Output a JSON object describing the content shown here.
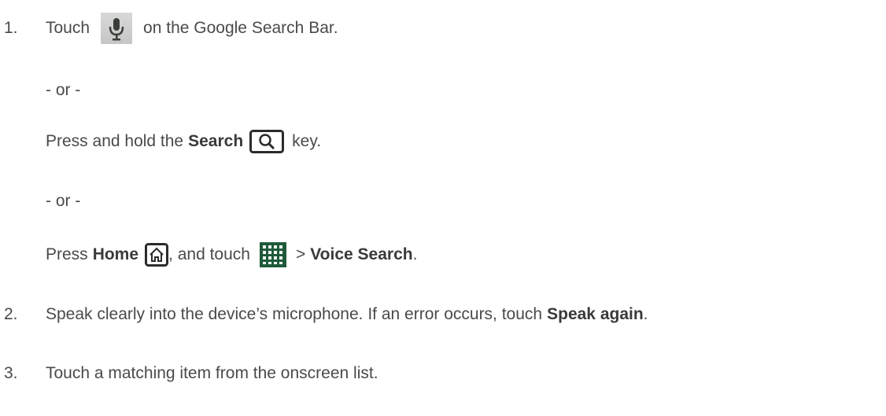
{
  "steps": [
    {
      "number": "1.",
      "lead": "Touch",
      "tail": "on the Google Search Bar."
    }
  ],
  "alt1": {
    "or": "- or -",
    "press": "Press and hold the",
    "key_name": "Search",
    "tail": "key."
  },
  "alt2": {
    "or": "- or -",
    "press": "Press",
    "key_name": "Home",
    "mid": ", and touch",
    "arrow": ">",
    "target": "Voice Search",
    "tail": "."
  },
  "step2": {
    "number": "2.",
    "text": "Speak clearly into the device’s microphone. If an error occurs, touch",
    "bold": "Speak again",
    "tail": "."
  },
  "step3": {
    "number": "3.",
    "text": "Touch a matching item from the onscreen list."
  },
  "icons": {
    "mic": "microphone-icon",
    "search": "search-key-icon",
    "home": "home-key-icon",
    "apps": "apps-grid-icon"
  }
}
